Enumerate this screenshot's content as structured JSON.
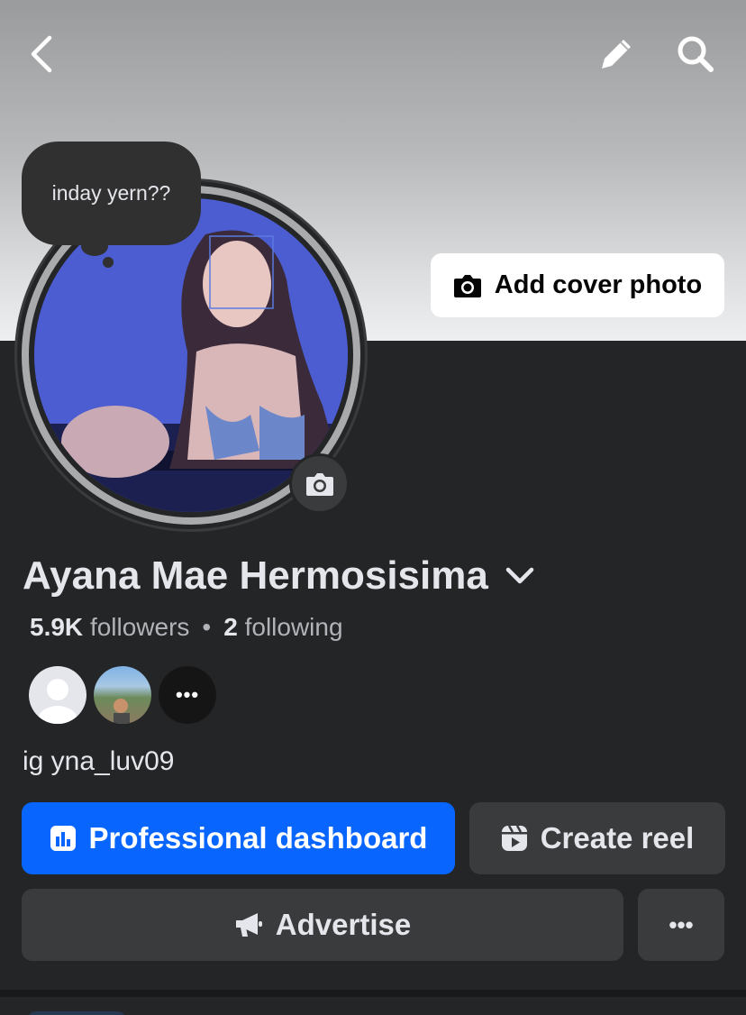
{
  "header": {
    "back_icon": "chevron-left-icon",
    "edit_icon": "pencil-icon",
    "search_icon": "search-icon",
    "add_cover_label": "Add cover photo"
  },
  "note": {
    "text": "inday yern??"
  },
  "profile": {
    "name": "Ayana Mae Hermosisima",
    "followers_count": "5.9K",
    "followers_label": "followers",
    "following_count": "2",
    "following_label": "following",
    "more_friends": "•••",
    "bio": "ig yna_luv09"
  },
  "actions": {
    "professional_dashboard": "Professional dashboard",
    "create_reel": "Create reel",
    "advertise": "Advertise",
    "more": "•••"
  },
  "colors": {
    "primary": "#0866ff",
    "background": "#242526",
    "secondary_button": "#3a3b3c"
  }
}
